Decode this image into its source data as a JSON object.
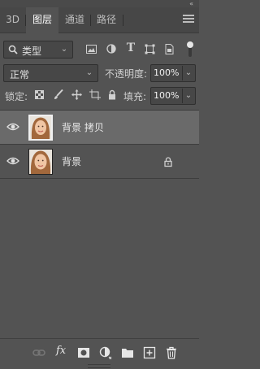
{
  "panel": {
    "collapse_glyph": "«",
    "tabs": [
      {
        "label": "3D"
      },
      {
        "label": "图层"
      },
      {
        "label": "通道"
      },
      {
        "label": "路径"
      }
    ],
    "active_tab": "图层"
  },
  "filter": {
    "kind_label": "类型",
    "icons": [
      "image-filter-icon",
      "adjustment-filter-icon",
      "type-filter-icon",
      "shape-filter-icon",
      "smart-object-filter-icon"
    ]
  },
  "blend": {
    "mode": "正常",
    "opacity_label": "不透明度:",
    "opacity_value": "100%"
  },
  "lock_row": {
    "lock_label": "锁定:",
    "fill_label": "填充:",
    "fill_value": "100%"
  },
  "layers": [
    {
      "name": "背景 拷贝",
      "visible": true,
      "selected": true,
      "locked": false
    },
    {
      "name": "背景",
      "visible": true,
      "selected": false,
      "locked": true
    }
  ],
  "bottom_icons": [
    "link-layers-icon",
    "fx-icon",
    "add-mask-icon",
    "adjustment-layer-icon",
    "new-group-icon",
    "new-layer-icon",
    "delete-layer-icon"
  ],
  "bottom_fx_label": "fx",
  "colors": {
    "panel": "#535353",
    "tabbar": "#474747",
    "selected_row": "#6a6a6a"
  }
}
